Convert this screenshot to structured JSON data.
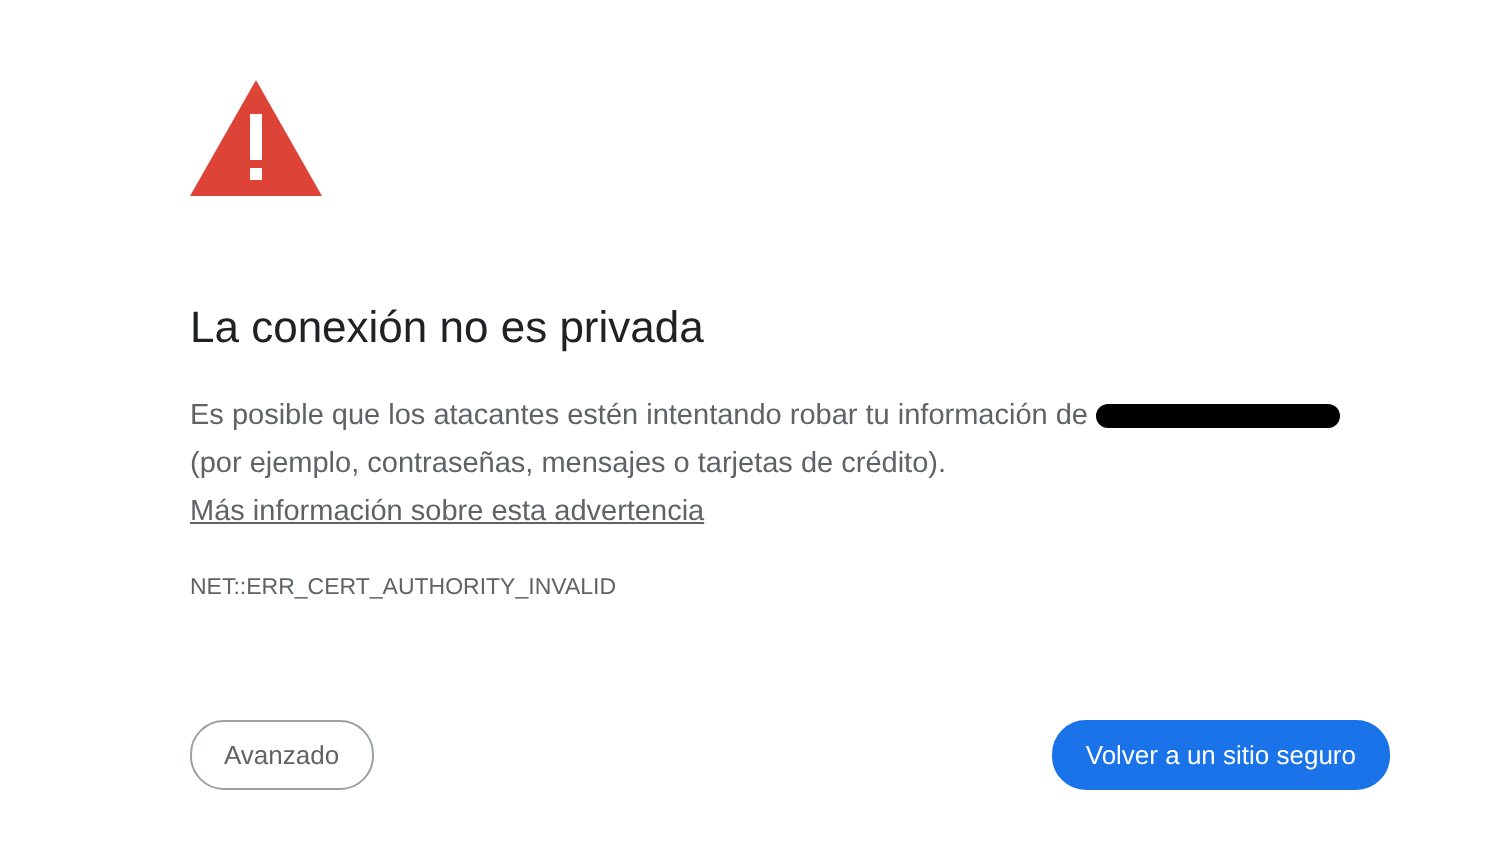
{
  "title": "La conexión no es privada",
  "message": {
    "text": "Es posible que los atacantes estén intentando robar tu información de",
    "redacted": true,
    "continuation": "(por ejemplo, contraseñas, mensajes o tarjetas de crédito).",
    "link": "Más información sobre esta advertencia"
  },
  "error_code": "NET::ERR_CERT_AUTHORITY_INVALID",
  "buttons": [
    {
      "label": "Avanzado",
      "kind": "secondary"
    },
    {
      "label": "Volver a un sitio seguro",
      "kind": "primary"
    }
  ]
}
